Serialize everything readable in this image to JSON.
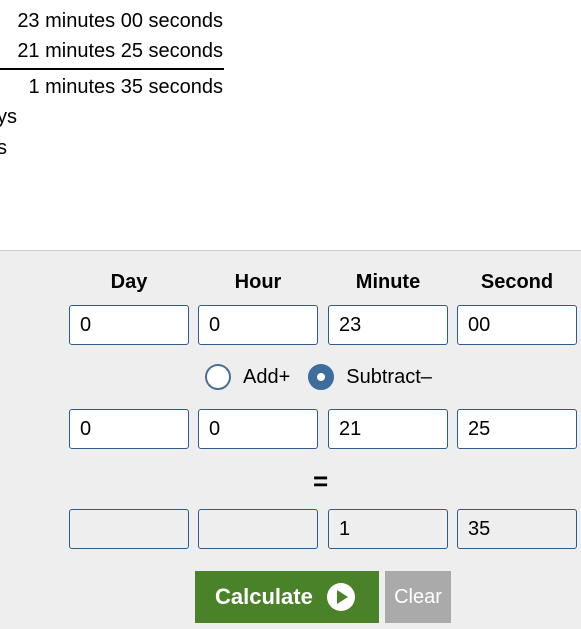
{
  "result": {
    "line1": "23 minutes 00 seconds",
    "line2": "21 minutes 25 seconds",
    "line3": "1 minutes 35 seconds",
    "frag1": "ys",
    "frag2": "s"
  },
  "headers": {
    "day": "Day",
    "hour": "Hour",
    "minute": "Minute",
    "second": "Second"
  },
  "row1": {
    "day": "0",
    "hour": "0",
    "minute": "23",
    "second": "00"
  },
  "operation": {
    "add_label": "Add+",
    "subtract_label": "Subtract–",
    "selected": "subtract"
  },
  "row2": {
    "day": "0",
    "hour": "0",
    "minute": "21",
    "second": "25"
  },
  "equals_sign": "=",
  "row3": {
    "day": "",
    "hour": "",
    "minute": "1",
    "second": "35"
  },
  "buttons": {
    "calculate": "Calculate",
    "clear": "Clear"
  },
  "colors": {
    "calculate_bg": "#4a8229",
    "clear_bg": "#aaaaaa",
    "panel_bg": "#eeeeee",
    "field_border": "#2d5b8a"
  }
}
